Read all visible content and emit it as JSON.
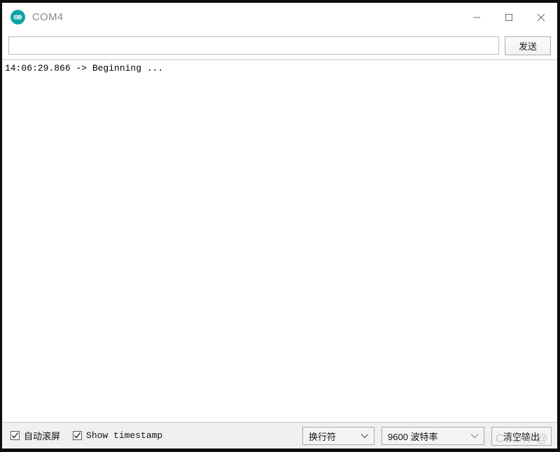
{
  "window": {
    "title": "COM4",
    "app_icon": "arduino-infinity-icon",
    "accent_color": "#12a3a8",
    "controls": {
      "minimize": "minimize-icon",
      "maximize": "maximize-icon",
      "close": "close-icon"
    }
  },
  "send_row": {
    "input_value": "",
    "input_placeholder": "",
    "send_label": "发送"
  },
  "console": {
    "lines": [
      "14:06:29.866 -> Beginning ..."
    ]
  },
  "status_bar": {
    "autoscroll": {
      "label": "自动滚屏",
      "checked": true
    },
    "show_timestamp": {
      "label": "Show timestamp",
      "checked": true
    },
    "line_ending": {
      "selected": "换行符",
      "chevron": "chevron-down-icon"
    },
    "baud_rate": {
      "selected": "9600 波特率",
      "chevron": "chevron-down-icon"
    },
    "clear_output_label": "清空输出"
  },
  "watermark": {
    "text": "CSDN @"
  }
}
